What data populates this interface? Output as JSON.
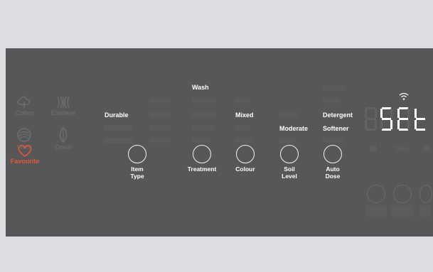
{
  "colors": {
    "panel": "#575757",
    "lit_text": "#ffffff",
    "dim_text": "#6a6a6a",
    "favourite": "#e8563a",
    "frame": "#dcdde0"
  },
  "cycles": [
    {
      "label": "Cotton",
      "icon": "cotton-icon",
      "active": false
    },
    {
      "label": "Elastane",
      "icon": "elastane-icon",
      "active": false
    },
    {
      "label": "Wool",
      "icon": "wool-icon",
      "active": false
    },
    {
      "label": "Down",
      "icon": "down-icon",
      "active": false
    },
    {
      "label": "Favourite",
      "icon": "heart-icon",
      "active": true
    }
  ],
  "sections": {
    "wash_header": "Wash",
    "item_type": {
      "options": [
        "",
        "Durable",
        "",
        ""
      ],
      "lit": "Durable"
    },
    "treatment": {
      "options": [
        "",
        "",
        "",
        ""
      ]
    },
    "colour": {
      "selected": "Mixed"
    },
    "soil_level": {
      "selected": "Moderate"
    },
    "auto_dose": {
      "options": [
        "",
        "",
        "Detergent",
        "Softener",
        ""
      ],
      "lit": [
        "Detergent",
        "Softener"
      ]
    }
  },
  "buttons": [
    {
      "label": "Item\nType",
      "line1": "Item",
      "line2": "Type"
    },
    {
      "label": "Treatment",
      "line1": "Treatment",
      "line2": ""
    },
    {
      "label": "Colour",
      "line1": "Colour",
      "line2": ""
    },
    {
      "label": "Soil Level",
      "line1": "Soil",
      "line2": "Level"
    },
    {
      "label": "Auto Dose",
      "line1": "Auto",
      "line2": "Dose"
    }
  ],
  "display": {
    "text": "SEt",
    "wifi": "wifi-icon"
  },
  "right_dim": {
    "days_label": "Days"
  }
}
